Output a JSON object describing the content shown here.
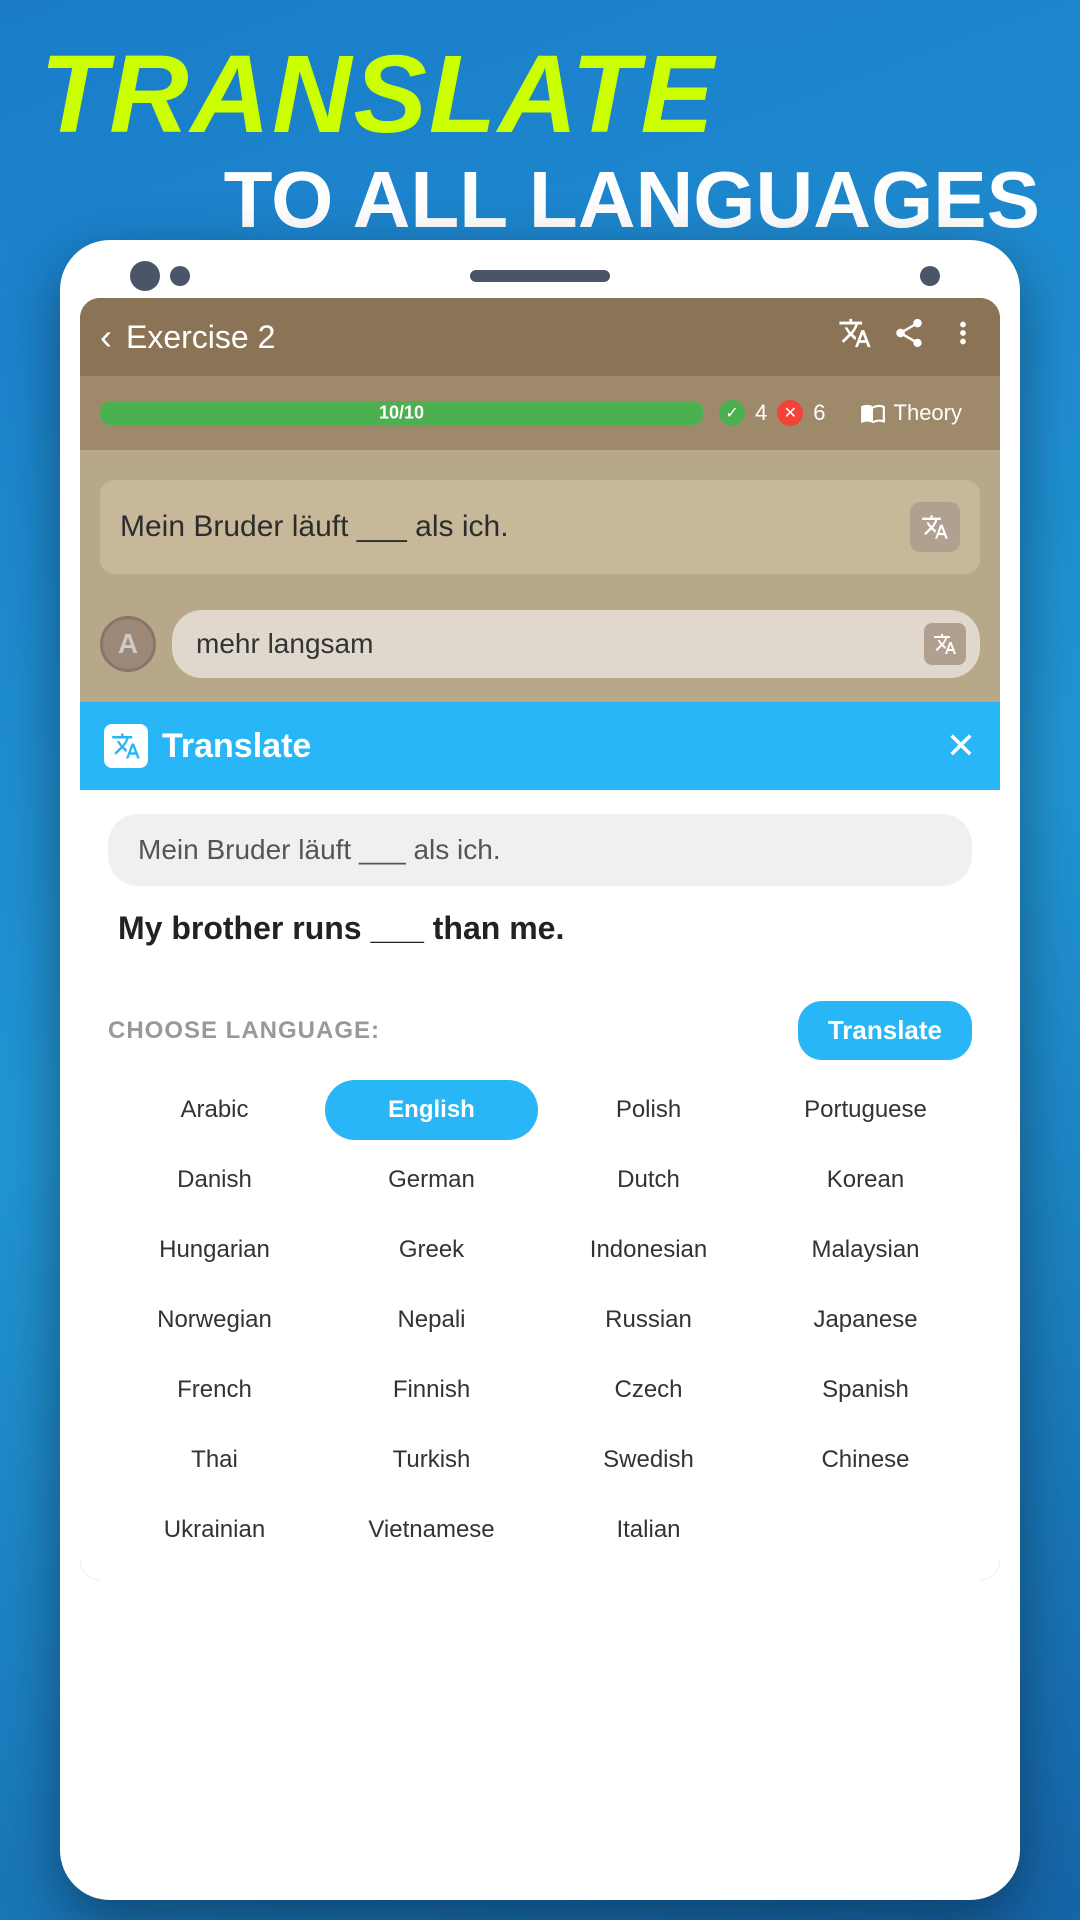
{
  "background": {
    "color": "#1a7cc9"
  },
  "title": {
    "main": "TRANSLATE",
    "subtitle": "TO ALL LANGUAGES"
  },
  "app": {
    "header": {
      "back_label": "‹",
      "title": "Exercise 2",
      "translate_icon": "🔤",
      "share_icon": "⬆",
      "more_icon": "⋮"
    },
    "progress": {
      "value": "10/10",
      "correct": "4",
      "wrong": "6",
      "theory_label": "Theory"
    },
    "question": {
      "text": "Mein Bruder läuft ___ als ich.",
      "translate_icon": "🔡"
    },
    "answer": {
      "avatar_label": "A",
      "value": "mehr langsam"
    },
    "translate_dialog": {
      "title": "Translate",
      "close": "✕",
      "source_text": "Mein Bruder läuft ___ als ich.",
      "translated_text": "My brother runs ___ than me.",
      "choose_language_label": "CHOOSE LANGUAGE:",
      "translate_button": "Translate",
      "selected_language": "English",
      "languages": [
        [
          "Arabic",
          "English",
          "Polish",
          "Portuguese"
        ],
        [
          "Danish",
          "German",
          "Dutch",
          "Korean"
        ],
        [
          "Hungarian",
          "Greek",
          "Indonesian",
          "Malaysian"
        ],
        [
          "Norwegian",
          "Nepali",
          "Russian",
          "Japanese"
        ],
        [
          "French",
          "Finnish",
          "Czech",
          "Spanish"
        ],
        [
          "Thai",
          "Turkish",
          "Swedish",
          "Chinese"
        ],
        [
          "Ukrainian",
          "Vietnamese",
          "Italian",
          ""
        ]
      ]
    }
  }
}
